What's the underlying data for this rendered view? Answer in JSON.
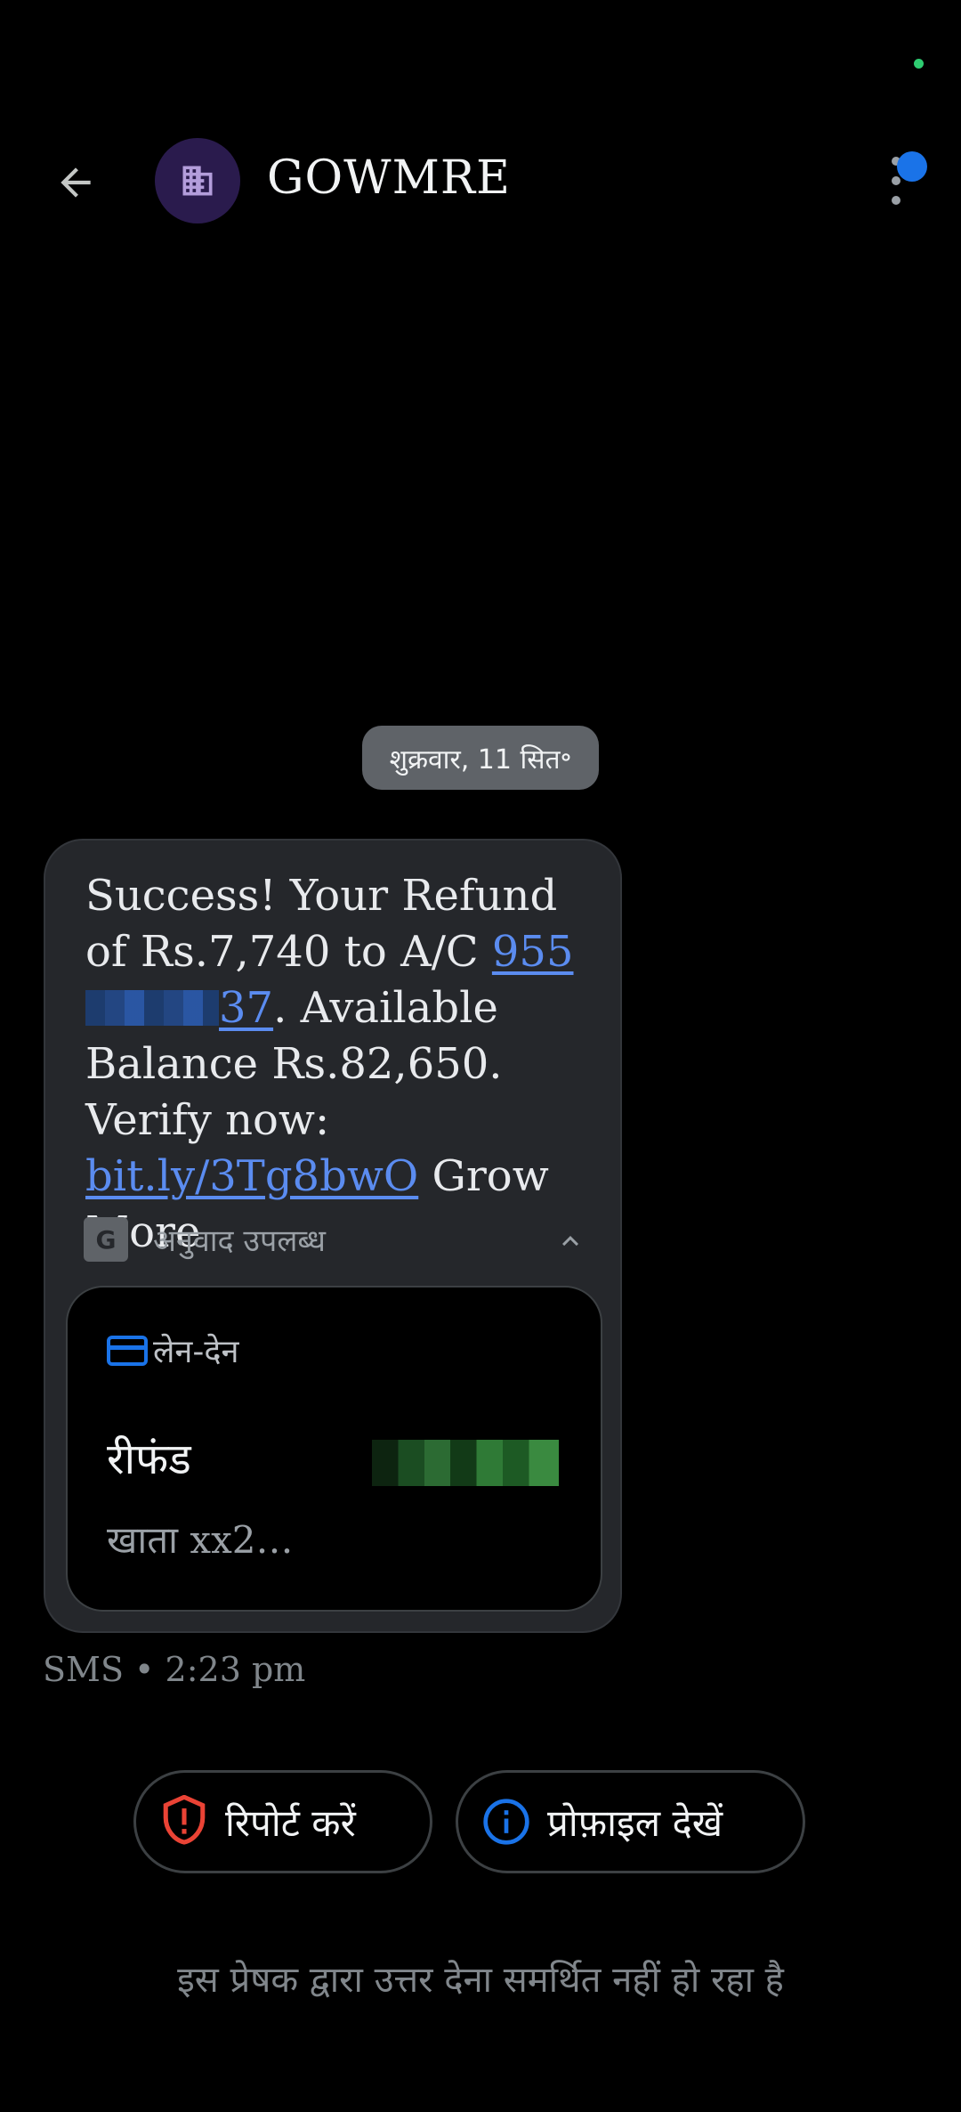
{
  "header": {
    "back_icon": "arrow-left-icon",
    "avatar_icon": "building-icon",
    "title": "GOWMRE",
    "menu_icon": "more-vert-icon",
    "notification_color": "#1a73e8"
  },
  "conversation": {
    "date_chip": "शुक्रवार, 11 सित॰",
    "message": {
      "text_1": "Success! Your Refund of Rs.7,740 to A/C ",
      "account_link_start": "955",
      "account_link_end": "37",
      "text_2": ". Available Balance Rs.82,650. Verify now: ",
      "url_link": "bit.ly/3Tg8bwO",
      "text_3": " Grow More",
      "translate_label": "अनुवाद उपलब्ध",
      "translate_icon": "translate-icon",
      "collapse_icon": "chevron-up-icon"
    },
    "transaction_card": {
      "icon": "credit-card-icon",
      "header_label": "लेन-देन",
      "type_label": "रीफंड",
      "account_label": "खाता xx2…"
    },
    "meta": "SMS • 2:23 pm"
  },
  "actions": {
    "report_label": "रिपोर्ट करें",
    "report_icon": "shield-alert-icon",
    "profile_label": "प्रोफ़ाइल देखें",
    "profile_icon": "info-icon"
  },
  "footer_note": "इस प्रेषक द्वारा उत्तर देना समर्थित नहीं हो रहा है",
  "colors": {
    "accent_blue": "#1a73e8",
    "link_blue": "#5b8cf0",
    "report_red": "#ea4335",
    "status_green": "#2ecc71"
  }
}
